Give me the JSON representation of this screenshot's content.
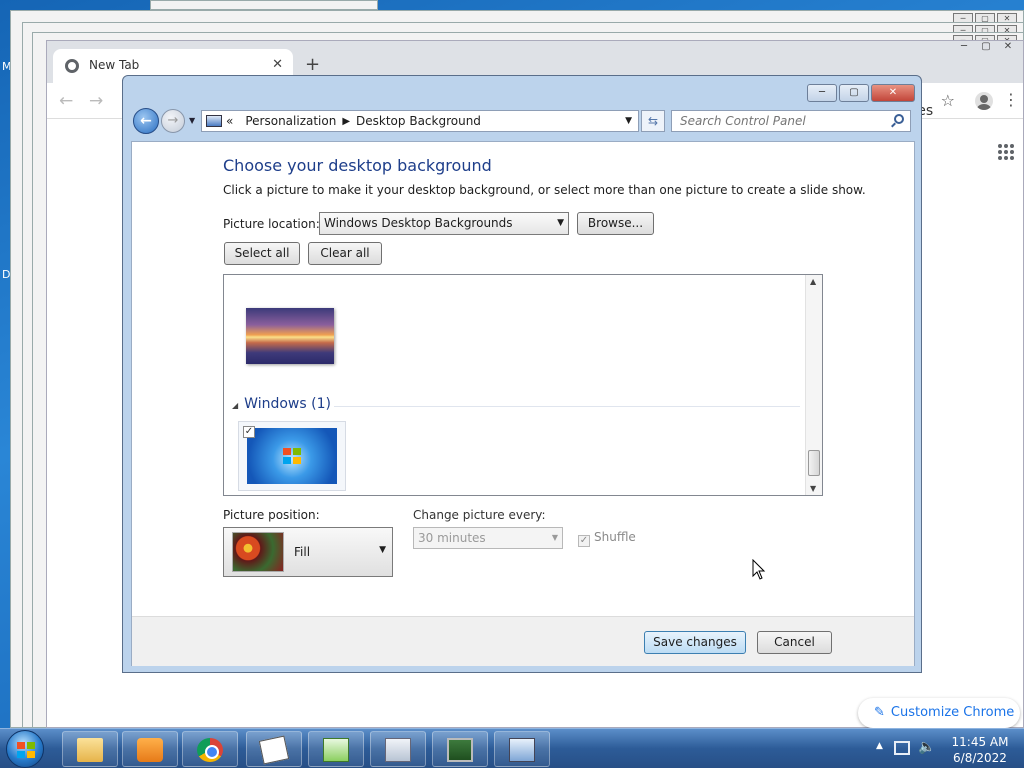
{
  "desktop": {
    "label_m": "M",
    "label_d": "D"
  },
  "chrome": {
    "tab_title": "New Tab",
    "images_link": "Images",
    "customize_label": "Customize Chrome"
  },
  "cp": {
    "breadcrumb": [
      "Personalization",
      "Desktop Background"
    ],
    "search_placeholder": "Search Control Panel",
    "heading": "Choose your desktop background",
    "description": "Click a picture to make it your desktop background, or select more than one picture to create a slide show.",
    "location_label": "Picture location:",
    "location_value": "Windows Desktop Backgrounds",
    "browse_label": "Browse...",
    "select_all_label": "Select all",
    "clear_all_label": "Clear all",
    "group_name": "Windows (1)",
    "position_label": "Picture position:",
    "position_value": "Fill",
    "change_label": "Change picture every:",
    "change_value": "30 minutes",
    "shuffle_label": "Shuffle",
    "save_label": "Save changes",
    "cancel_label": "Cancel"
  },
  "taskbar": {
    "items": [
      "folder-icon",
      "media-player-icon",
      "chrome-icon",
      "solitaire-icon",
      "notepad-icon",
      "calculator-icon",
      "monitor-icon",
      "control-panel-icon"
    ],
    "time": "11:45 AM",
    "date": "6/8/2022"
  }
}
